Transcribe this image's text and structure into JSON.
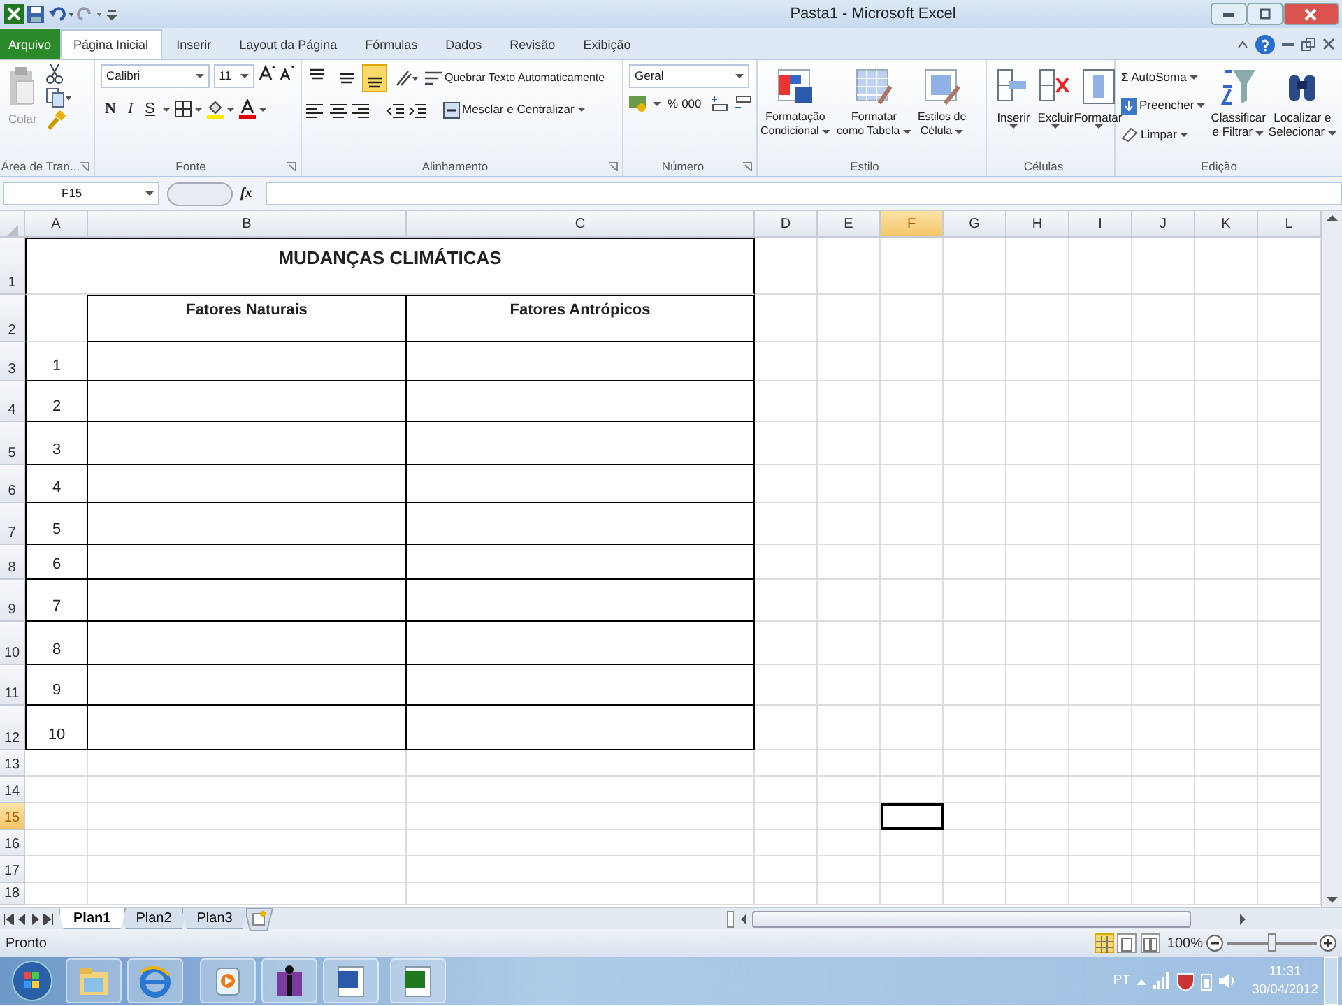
{
  "window": {
    "title": "Pasta1 - Microsoft Excel"
  },
  "ribbon_tabs": [
    {
      "label": "Arquivo",
      "kind": "file",
      "selected": false
    },
    {
      "label": "Página Inicial",
      "kind": "tab",
      "selected": true
    },
    {
      "label": "Inserir",
      "kind": "tab",
      "selected": false
    },
    {
      "label": "Layout da Página",
      "kind": "tab",
      "selected": false
    },
    {
      "label": "Fórmulas",
      "kind": "tab",
      "selected": false
    },
    {
      "label": "Dados",
      "kind": "tab",
      "selected": false
    },
    {
      "label": "Revisão",
      "kind": "tab",
      "selected": false
    },
    {
      "label": "Exibição",
      "kind": "tab",
      "selected": false
    }
  ],
  "ribbon": {
    "clipboard": {
      "label": "Área de Tran...",
      "paste": "Colar"
    },
    "font": {
      "label": "Fonte",
      "font_name": "Calibri",
      "font_size": "11",
      "bold": "N",
      "italic": "I",
      "underline": "S"
    },
    "alignment": {
      "label": "Alinhamento",
      "vertical_align": [
        {
          "kind": "top",
          "selected": false
        },
        {
          "kind": "middle",
          "selected": false
        },
        {
          "kind": "bottom",
          "selected": true
        }
      ],
      "wrap_text": "Quebrar Texto Automaticamente",
      "merge": "Mesclar e Centralizar"
    },
    "number": {
      "label": "Número",
      "format": "Geral",
      "percent": "%",
      "thousands": "000"
    },
    "styles": {
      "label": "Estilo",
      "buttons": [
        {
          "line1": "Formatação",
          "line2": "Condicional"
        },
        {
          "line1": "Formatar",
          "line2": "como Tabela"
        },
        {
          "line1": "Estilos de",
          "line2": "Célula"
        }
      ]
    },
    "cells": {
      "label": "Células",
      "buttons": [
        "Inserir",
        "Excluir",
        "Formatar"
      ]
    },
    "editing": {
      "label": "Edição",
      "sum_sign": "Σ",
      "items": [
        "AutoSoma",
        "Preencher",
        "Limpar"
      ],
      "buttons": [
        {
          "line1": "Classificar",
          "line2": "e Filtrar"
        },
        {
          "line1": "Localizar e",
          "line2": "Selecionar"
        }
      ]
    }
  },
  "formula_bar": {
    "name_box": "F15",
    "fx": "fx"
  },
  "sheet": {
    "columns": [
      {
        "label": "A",
        "selected": false
      },
      {
        "label": "B",
        "selected": false
      },
      {
        "label": "C",
        "selected": false
      },
      {
        "label": "D",
        "selected": false
      },
      {
        "label": "E",
        "selected": false
      },
      {
        "label": "F",
        "selected": true
      },
      {
        "label": "G",
        "selected": false
      },
      {
        "label": "H",
        "selected": false
      },
      {
        "label": "I",
        "selected": false
      },
      {
        "label": "J",
        "selected": false
      },
      {
        "label": "K",
        "selected": false
      },
      {
        "label": "L",
        "selected": false
      }
    ],
    "rows": [
      {
        "label": "1",
        "selected": false
      },
      {
        "label": "2",
        "selected": false
      },
      {
        "label": "3",
        "selected": false
      },
      {
        "label": "4",
        "selected": false
      },
      {
        "label": "5",
        "selected": false
      },
      {
        "label": "6",
        "selected": false
      },
      {
        "label": "7",
        "selected": false
      },
      {
        "label": "8",
        "selected": false
      },
      {
        "label": "9",
        "selected": false
      },
      {
        "label": "10",
        "selected": false
      },
      {
        "label": "11",
        "selected": false
      },
      {
        "label": "12",
        "selected": false
      },
      {
        "label": "13",
        "selected": false
      },
      {
        "label": "14",
        "selected": false
      },
      {
        "label": "15",
        "selected": true
      },
      {
        "label": "16",
        "selected": false
      },
      {
        "label": "17",
        "selected": false
      },
      {
        "label": "18",
        "selected": false
      }
    ],
    "title": "MUDANÇAS CLIMÁTICAS",
    "headers": [
      "Fatores Naturais",
      "Fatores Antrópicos"
    ],
    "numbers": [
      "1",
      "2",
      "3",
      "4",
      "5",
      "6",
      "7",
      "8",
      "9",
      "10"
    ]
  },
  "sheet_tabs": [
    {
      "label": "Plan1",
      "selected": true
    },
    {
      "label": "Plan2",
      "selected": false
    },
    {
      "label": "Plan3",
      "selected": false
    }
  ],
  "status_bar": {
    "text": "Pronto",
    "views": [
      {
        "kind": "normal",
        "selected": true
      },
      {
        "kind": "page-layout",
        "selected": false
      },
      {
        "kind": "page-break",
        "selected": false
      }
    ],
    "zoom": "100%",
    "zoom_slider": {
      "level": 0.5
    }
  },
  "taskbar": {
    "language": "PT",
    "time": "11:31",
    "date": "30/04/2012"
  }
}
